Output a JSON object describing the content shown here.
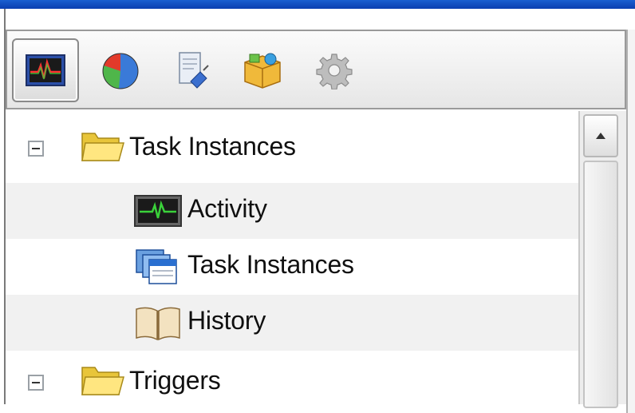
{
  "toolbar": {
    "buttons": [
      {
        "icon": "activity-monitor-icon",
        "active": true
      },
      {
        "icon": "pie-chart-icon",
        "active": false
      },
      {
        "icon": "document-plug-icon",
        "active": false
      },
      {
        "icon": "package-box-icon",
        "active": false
      },
      {
        "icon": "gear-icon",
        "active": false
      }
    ]
  },
  "tree": {
    "items": [
      {
        "label": "Task Instances",
        "icon": "folder-icon",
        "expanded": true,
        "level": 0
      },
      {
        "label": "Activity",
        "icon": "activity-monitor-icon",
        "level": 1
      },
      {
        "label": "Task Instances",
        "icon": "stacked-windows-icon",
        "level": 1
      },
      {
        "label": "History",
        "icon": "book-icon",
        "level": 1
      },
      {
        "label": "Triggers",
        "icon": "folder-icon",
        "expanded": true,
        "level": 0
      }
    ]
  },
  "colors": {
    "titlebar": "#1a5fd0",
    "row_alt": "#f1f1f1",
    "toolbar_bg": "#e6e6e6"
  }
}
